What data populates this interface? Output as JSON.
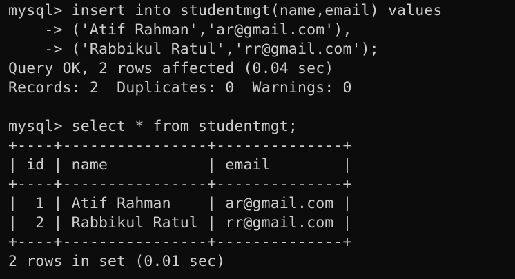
{
  "terminal": {
    "lines": [
      "mysql> insert into studentmgt(name,email) values",
      "    -> ('Atif Rahman','ar@gmail.com'),",
      "    -> ('Rabbikul Ratul','rr@gmail.com');",
      "Query OK, 2 rows affected (0.04 sec)",
      "Records: 2  Duplicates: 0  Warnings: 0",
      "",
      "mysql> select * from studentmgt;",
      "+----+----------------+--------------+",
      "| id | name           | email        |",
      "+----+----------------+--------------+",
      "|  1 | Atif Rahman    | ar@gmail.com |",
      "|  2 | Rabbikul Ratul | rr@gmail.com |",
      "+----+----------------+--------------+",
      "2 rows in set (0.01 sec)"
    ]
  },
  "colors": {
    "background": "#0c0c0c",
    "foreground": "#cccccc"
  }
}
